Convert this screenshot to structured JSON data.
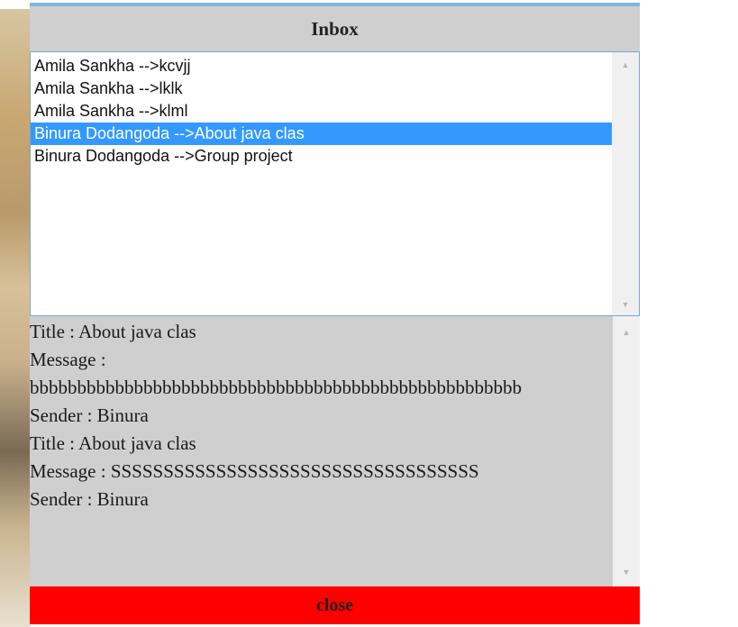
{
  "inbox": {
    "title": "Inbox",
    "items": [
      {
        "label": "Amila Sankha -->kcvjj",
        "selected": false
      },
      {
        "label": "Amila Sankha -->lklk",
        "selected": false
      },
      {
        "label": "Amila Sankha -->klml",
        "selected": false
      },
      {
        "label": "Binura Dodangoda -->About java clas",
        "selected": true
      },
      {
        "label": "Binura Dodangoda -->Group project",
        "selected": false
      }
    ]
  },
  "message_panel": {
    "lines": [
      "Title : About java clas",
      "Message :",
      "bbbbbbbbbbbbbbbbbbbbbbbbbbbbbbbbbbbbbbbbbbbbbbbbbbbb",
      "Sender : Binura",
      "Title : About java clas",
      "Message : SSSSSSSSSSSSSSSSSSSSSSSSSSSSSSSSSSS",
      "Sender : Binura"
    ]
  },
  "close_button": {
    "label": "close",
    "color": "#ff0000"
  },
  "colors": {
    "selection": "#3399ff",
    "dialog_background": "#cfcfcf",
    "accent_border": "#7fb8d6"
  },
  "icons": {
    "scroll_up": "scroll-up-arrow-icon",
    "scroll_down": "scroll-down-arrow-icon"
  }
}
